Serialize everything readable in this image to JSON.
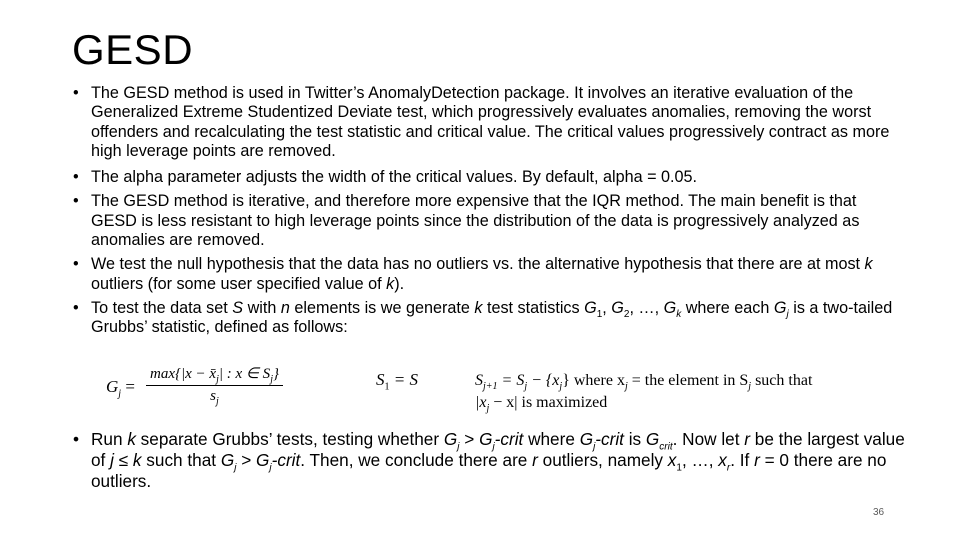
{
  "slide": {
    "title": "GESD",
    "page_number": "36",
    "bullet_glyph": "•",
    "bullets": [
      {
        "text": "The GESD method is used in Twitter’s AnomalyDetection package. It involves an iterative evaluation of the Generalized Extreme Studentized Deviate test, which progressively evaluates anomalies, removing the worst offenders and recalculating the test statistic and critical value. The critical values progressively contract as more high leverage points are removed."
      },
      {
        "text": "The alpha parameter adjusts the width of the critical values. By default, alpha = 0.05."
      },
      {
        "text": "The GESD method is iterative, and therefore more expensive that the IQR method. The main benefit is that GESD is less resistant to high leverage points since the distribution of the data is progressively analyzed as anomalies are removed."
      },
      {
        "parts": [
          "We test the null hypothesis that the data has no outliers vs. the alternative hypothesis that there are at most ",
          "k",
          " outliers (for some user specified value of ",
          "k",
          ")."
        ]
      },
      {
        "parts": [
          "To test the data set ",
          "S",
          " with ",
          "n",
          " elements is we generate ",
          "k",
          " test statistics ",
          "G",
          "1",
          ", ",
          "G",
          "2",
          ", …, ",
          "G",
          "k",
          " where each ",
          "G",
          "j",
          " is a two-tailed Grubbs’ statistic, defined as follows:"
        ]
      },
      {
        "parts": [
          "Run ",
          "k",
          " separate Grubbs’ tests, testing whether ",
          "G",
          "j",
          " > ",
          "G",
          "j",
          "-crit",
          "  where ",
          "G",
          "j",
          "-crit",
          " is ",
          "G",
          "crit",
          ".  Now let ",
          "r",
          " be the largest value of ",
          "j ≤ k",
          " such that ",
          "G",
          "j",
          " > ",
          "G",
          "j",
          "-crit",
          ". Then, we conclude there are ",
          "r",
          " outliers, namely ",
          "x",
          "1",
          ", …, ",
          "x",
          "r",
          ". If ",
          "r",
          " = 0 there are no outliers."
        ]
      }
    ],
    "formula": {
      "lhs": "G",
      "lhs_sub": "j",
      "equals": " = ",
      "numerator": "max{|x − x̄",
      "numerator_sub": "j",
      "numerator_tail": "| : x ∈ S",
      "numerator_sub2": "j",
      "numerator_close": "}",
      "denominator": "s",
      "denominator_sub": "j"
    },
    "set_init": {
      "lhs": "S",
      "lhs_sub": "1",
      "rhs": " = S"
    },
    "set_update": {
      "line1_a": "S",
      "line1_sub1": "j+1",
      "line1_b": " = S",
      "line1_sub2": "j",
      "line1_c": " − {x",
      "line1_sub3": "j",
      "line1_d": "} where x",
      "line1_sub4": "j",
      "line1_e": " = the element  in S",
      "line1_sub5": "j",
      "line1_f": " such that",
      "line2_a": "|x",
      "line2_sub": "j",
      "line2_b": " − x| is maximized"
    }
  }
}
